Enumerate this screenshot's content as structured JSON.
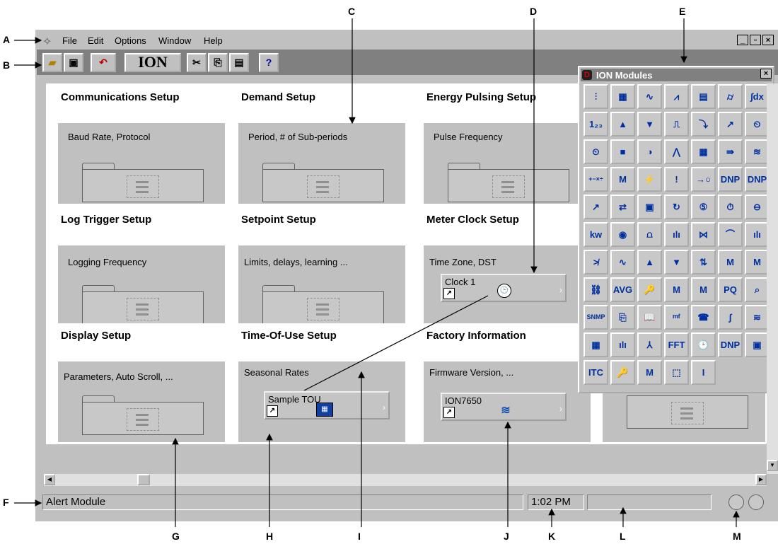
{
  "menu": {
    "items": [
      "File",
      "Edit",
      "Options",
      "Window",
      "Help"
    ],
    "mnemonics": [
      "F",
      "E",
      "O",
      "W",
      "H"
    ]
  },
  "window_controls": [
    "_",
    "̅",
    "×"
  ],
  "toolbar": {
    "buttons": [
      {
        "name": "open",
        "glyph": "📂"
      },
      {
        "name": "save",
        "glyph": "💾"
      },
      {
        "name": "revert",
        "glyph": "↶"
      },
      {
        "name": "ion",
        "glyph": "ION"
      },
      {
        "name": "cut",
        "glyph": "✂"
      },
      {
        "name": "copy",
        "glyph": "⎘"
      },
      {
        "name": "paste",
        "glyph": "📋"
      },
      {
        "name": "help",
        "glyph": "?"
      }
    ]
  },
  "cards": [
    {
      "title": "Communications Setup",
      "desc": "Baud Rate, Protocol"
    },
    {
      "title": "Demand Setup",
      "desc": "Period, # of Sub-periods"
    },
    {
      "title": "Energy Pulsing Setup",
      "desc": "Pulse Frequency"
    },
    {
      "title": "Log Trigger Setup",
      "desc": "Logging Frequency"
    },
    {
      "title": "Setpoint Setup",
      "desc": "Limits, delays, learning ..."
    },
    {
      "title": "Meter Clock Setup",
      "desc": "Time Zone, DST",
      "module": "Clock 1"
    },
    {
      "title": "Display Setup",
      "desc": "Parameters, Auto Scroll, ..."
    },
    {
      "title": "Time-Of-Use Setup",
      "desc": "Seasonal Rates",
      "module": "Sample TOU"
    },
    {
      "title": "Factory Information",
      "desc": "Firmware Version, ...",
      "module": "ION7650"
    }
  ],
  "palette": {
    "title": "ION Modules",
    "close": "×",
    "rows": [
      [
        "⫶",
        "▦",
        "∿",
        "⩘",
        "▤",
        "⌭",
        "∫dx"
      ],
      [
        "1₂₃",
        "▲",
        "▼",
        "⎍",
        "⤵",
        "↗",
        "⏲"
      ],
      [
        "⏲",
        "■",
        "◑",
        "⋀",
        "▦",
        "⇛",
        "≋"
      ],
      [
        "+−×÷",
        "M",
        "⚡",
        "!",
        "→○",
        "DNP",
        "DNP"
      ],
      [
        "↗",
        "⇄",
        "▣",
        "↻",
        "⑤",
        "⏱",
        "⊖"
      ],
      [
        "kw",
        "◉",
        "⩍",
        "ılı",
        "⋈",
        "⌒",
        "ılı"
      ],
      [
        "≯",
        "∿",
        "▲",
        "▼",
        "⇅",
        "M",
        "M"
      ],
      [
        "⛓",
        "AVG",
        "🔑",
        "M",
        "M",
        "PQ",
        "⌕"
      ],
      [
        "SNMP",
        "⎘",
        "📖",
        "ᵐᶠ",
        "☎",
        "∫",
        "≋"
      ],
      [
        "▦",
        "ılı",
        "⅄",
        "FFT",
        "🕒",
        "DNP",
        "▣"
      ],
      [
        "ITC",
        "🔑",
        "M",
        "⬚",
        "I"
      ]
    ]
  },
  "status": {
    "message": "Alert Module",
    "time": "1:02 PM",
    "extra": ""
  },
  "callouts": [
    "A",
    "B",
    "C",
    "D",
    "E",
    "F",
    "G",
    "H",
    "I",
    "J",
    "K",
    "L",
    "M"
  ]
}
